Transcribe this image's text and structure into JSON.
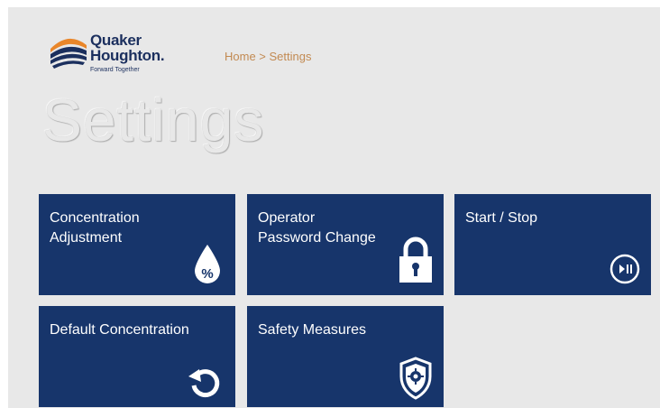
{
  "brand": {
    "name_line1": "Quaker",
    "name_line2": "Houghton.",
    "tagline": "Forward Together"
  },
  "breadcrumb": "Home > Settings",
  "page_title": "Settings",
  "tiles": [
    {
      "label": "Concentration\nAdjustment",
      "icon": "percent-drop-icon"
    },
    {
      "label": "Operator\nPassword Change",
      "icon": "padlock-icon"
    },
    {
      "label": "Start / Stop",
      "icon": "play-pause-icon"
    },
    {
      "label": "Default Concentration",
      "icon": "reset-icon"
    },
    {
      "label": "Safety Measures",
      "icon": "shield-icon"
    }
  ],
  "colors": {
    "tile": "#17356b",
    "background": "#e8e8e8",
    "breadcrumb": "#c28a52",
    "logo_orange": "#e9862a",
    "logo_navy": "#1b2f5e"
  }
}
